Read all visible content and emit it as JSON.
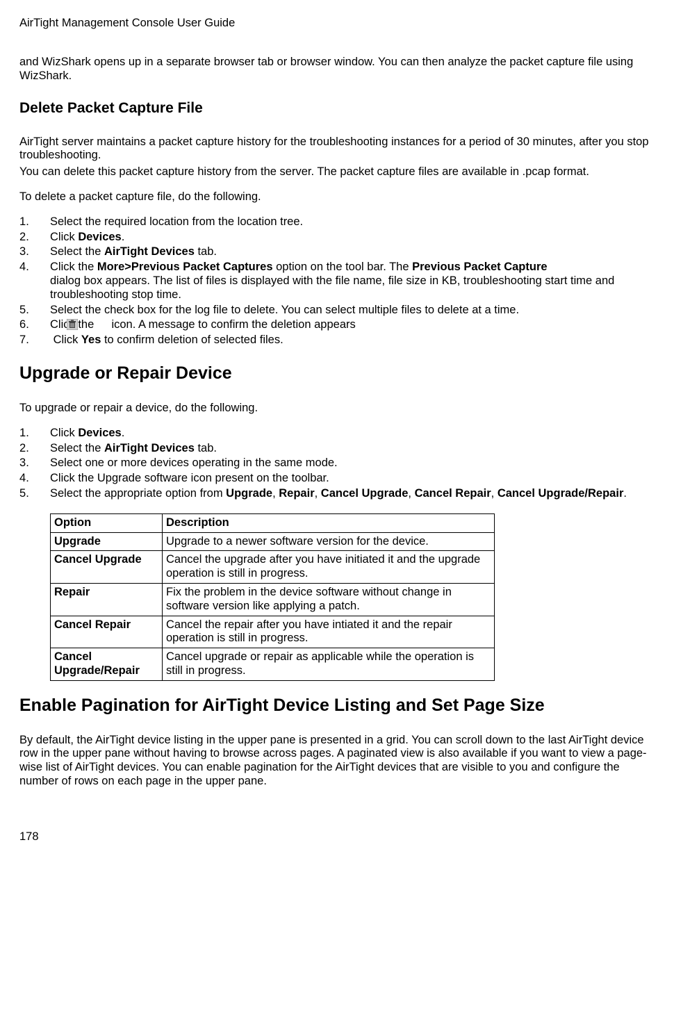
{
  "header": "AirTight Management Console User Guide",
  "intro_para": "and WizShark opens up in a separate browser tab or browser window. You can then analyze the packet capture file using WizShark.",
  "delete_section": {
    "heading": "Delete Packet Capture File",
    "p1": "AirTight server maintains a packet capture history for the troubleshooting instances for a period of 30 minutes, after you stop troubleshooting.",
    "p2": "You can delete this packet capture history from the server. The packet capture files are available in .pcap format.",
    "p3": "To delete a packet capture file, do the following.",
    "steps": {
      "s1": "Select the required location from the location tree.",
      "s2a": "Click ",
      "s2b": "Devices",
      "s2c": ".",
      "s3a": "Select the ",
      "s3b": "AirTight Devices",
      "s3c": " tab.",
      "s4a": "Click the ",
      "s4b": "More>Previous Packet Captures",
      "s4c": " option on the tool bar. The ",
      "s4d": "Previous Packet Capture",
      "s4e": " dialog box appears. The list of files is displayed with the file name, file size in KB, troubleshooting start time and troubleshooting stop time.",
      "s5": "Select the check box for the log file to delete. You can select multiple files to delete at a time.",
      "s6a": "Click the ",
      "s6b": " icon. A message to confirm the deletion appears",
      "s7a": " Click ",
      "s7b": "Yes",
      "s7c": " to confirm deletion of selected files."
    }
  },
  "upgrade_section": {
    "heading": "Upgrade or Repair Device",
    "p1": "To upgrade or repair a device, do the following.",
    "steps": {
      "s1a": "Click ",
      "s1b": "Devices",
      "s1c": ".",
      "s2a": "Select the ",
      "s2b": "AirTight Devices",
      "s2c": " tab.",
      "s3": "Select one or more devices operating in the same mode.",
      "s4": "Click the Upgrade software icon present on the toolbar.",
      "s5a": "Select the appropriate option from ",
      "s5b": "Upgrade",
      "s5c": ", ",
      "s5d": "Repair",
      "s5e": ", ",
      "s5f": "Cancel Upgrade",
      "s5g": ", ",
      "s5h": "Cancel Repair",
      "s5i": ", ",
      "s5j": "Cancel Upgrade/Repair",
      "s5k": "."
    },
    "table": {
      "h1": "Option",
      "h2": "Description",
      "rows": [
        {
          "opt": "Upgrade",
          "desc": "Upgrade to a newer software version for the device."
        },
        {
          "opt": "Cancel Upgrade",
          "desc": "Cancel the upgrade after you have initiated it and the upgrade operation is still in progress."
        },
        {
          "opt": "Repair",
          "desc": "Fix the problem in the device software without change in software version like applying a patch."
        },
        {
          "opt": "Cancel Repair",
          "desc": "Cancel the repair after you have intiated it and the repair operation is still in progress."
        },
        {
          "opt": "Cancel Upgrade/Repair",
          "desc": "Cancel upgrade or repair as applicable while the operation is still in progress."
        }
      ]
    }
  },
  "pagination_section": {
    "heading": "Enable Pagination for AirTight Device Listing and Set Page Size",
    "p1": "By default, the AirTight device listing in the upper pane is presented in a grid. You can scroll down to the last AirTight device row in the upper pane without having to browse across pages. A paginated view is also available if you want to view a page-wise list of AirTight devices. You can enable pagination for the AirTight devices that are visible to you and configure the number of rows on each page in the upper pane."
  },
  "page_number": "178"
}
